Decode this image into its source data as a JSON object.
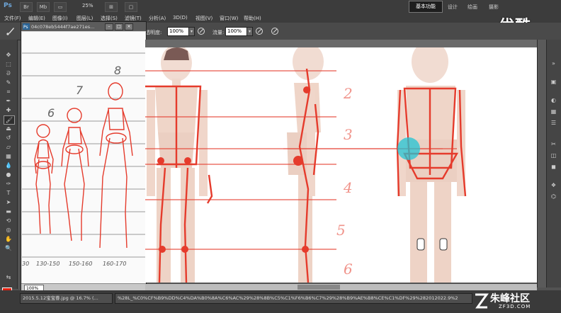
{
  "app": {
    "logo": "Ps",
    "zoom": "25%",
    "icons": [
      "br-icon",
      "mb-icon",
      "layout-icon",
      "arrange-icon"
    ]
  },
  "workspace": {
    "active": "基本功能",
    "items": [
      "设计",
      "绘画",
      "摄影"
    ],
    "more": "»"
  },
  "watermark": {
    "top": "优酷",
    "brand_cn": "朱峰社区",
    "brand_en": "ZF3D.COM"
  },
  "menu": [
    "文件(F)",
    "编辑(E)",
    "图像(I)",
    "图层(L)",
    "选择(S)",
    "滤镜(T)",
    "分析(A)",
    "3D(D)",
    "视图(V)",
    "窗口(W)",
    "帮助(H)"
  ],
  "options": {
    "opacity_label": "透明度:",
    "opacity_value": "100%",
    "flow_label": "流量:",
    "flow_value": "100%"
  },
  "float_doc": {
    "title": "04c078eb5444f7ae271es...",
    "zoom": "100%"
  },
  "sketch": {
    "numbers": [
      "6",
      "7",
      "8"
    ],
    "labels": [
      "130-150",
      "150-160",
      "160-170"
    ],
    "left_labels": [
      "30",
      "130"
    ]
  },
  "main": {
    "ruler_numbers": [
      "2",
      "3",
      "4",
      "5",
      "6"
    ]
  },
  "status": {
    "doc_tab": "2015.5.12宝宝眷.jpg @ 16.7% (...",
    "url": "%28L_%C0%CF%B9%DD%C4%DA%B0%8A%C6%AC%29%28%8B%C5%C1%F6%B6%C7%29%28%B9%AE%B8%CE%C1%DF%29%282012022.9%2"
  },
  "colors": {
    "accent_red": "#e53b2c",
    "cyan_marker": "#22c4d4",
    "ps_blue": "#6fa8dc"
  }
}
